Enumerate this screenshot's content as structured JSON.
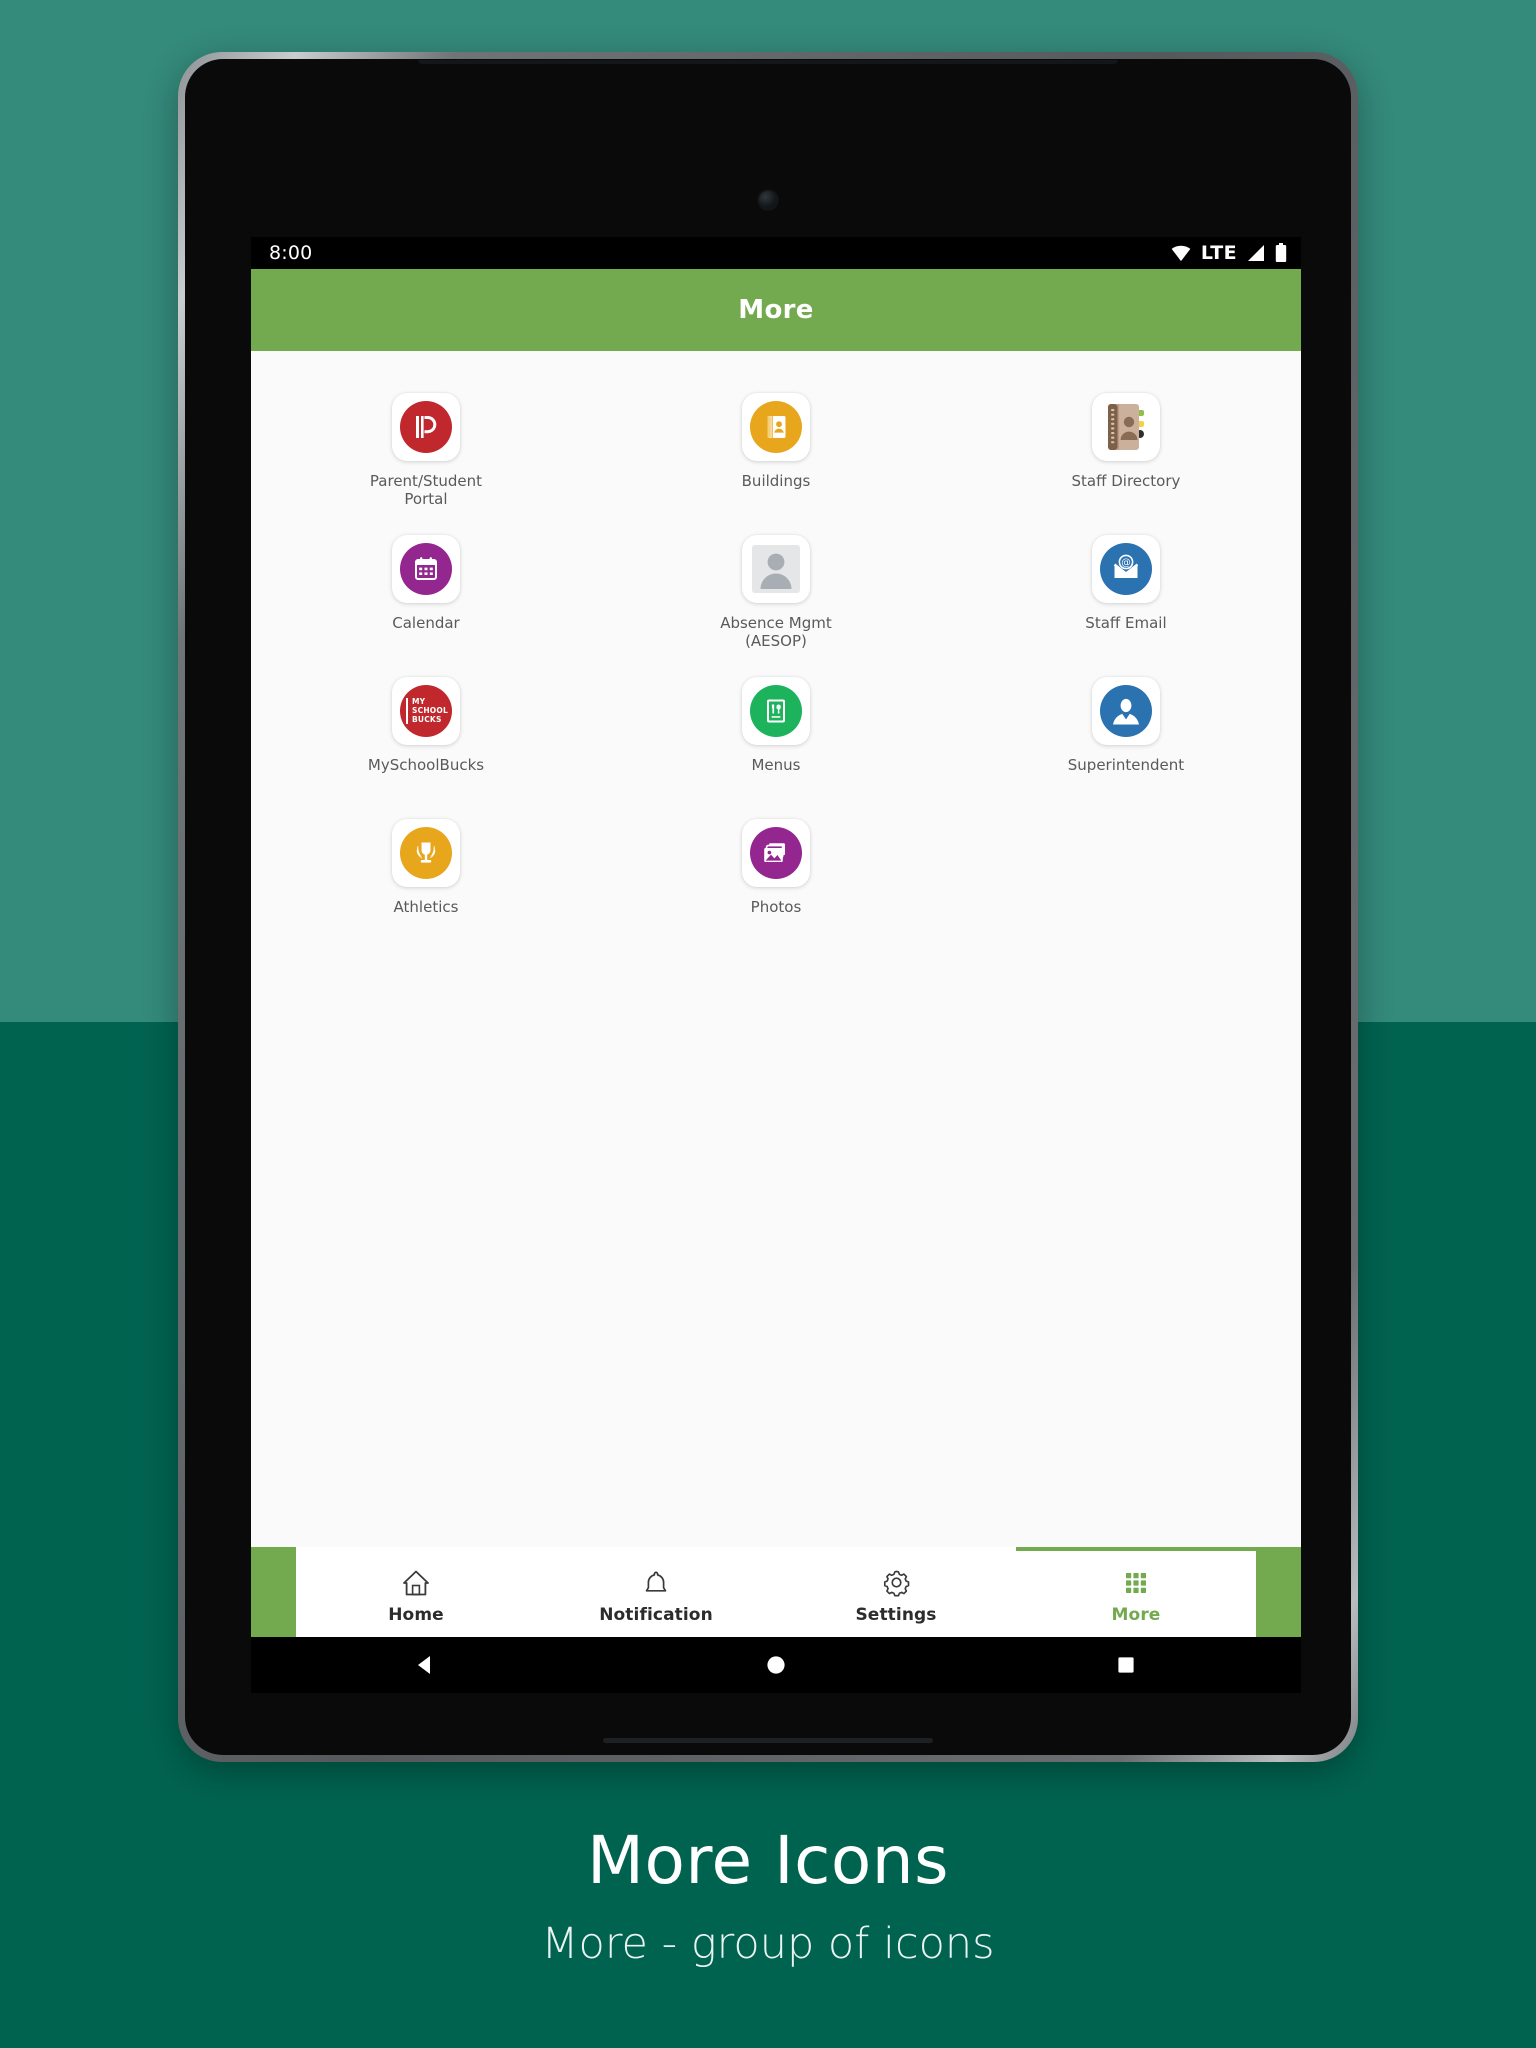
{
  "caption": {
    "title": "More Icons",
    "subtitle": "More - group of icons"
  },
  "colors": {
    "bg_top": "#348a7b",
    "bg_bottom": "#006350",
    "app_green": "#73a94f",
    "screen_bg": "#fafafa"
  },
  "status_bar": {
    "time": "8:00",
    "network": "LTE",
    "icons": [
      "wifi-icon",
      "signal-icon",
      "battery-icon"
    ]
  },
  "app_bar": {
    "title": "More"
  },
  "grid": {
    "rows": [
      [
        {
          "label": "Parent/Student\nPortal",
          "icon": "powerschool-icon",
          "color": "#c0282d"
        },
        {
          "label": "Buildings",
          "icon": "address-book-icon",
          "color": "#e8a61d"
        },
        {
          "label": "Staff Directory",
          "icon": "staff-directory-icon",
          "color": "#b79a86"
        }
      ],
      [
        {
          "label": "Calendar",
          "icon": "calendar-icon",
          "color": "#93278f"
        },
        {
          "label": "Absence Mgmt\n(AESOP)",
          "icon": "person-placeholder-icon",
          "color": "#e3e4e6"
        },
        {
          "label": "Staff Email",
          "icon": "email-at-icon",
          "color": "#2a72b0"
        }
      ],
      [
        {
          "label": "MySchoolBucks",
          "icon": "myschoolbucks-icon",
          "color": "#c0282d"
        },
        {
          "label": "Menus",
          "icon": "menu-card-icon",
          "color": "#1cb35c"
        },
        {
          "label": "Superintendent",
          "icon": "superintendent-icon",
          "color": "#2a72b0"
        }
      ],
      [
        {
          "label": "Athletics",
          "icon": "trophy-icon",
          "color": "#e8a61d"
        },
        {
          "label": "Photos",
          "icon": "photos-icon",
          "color": "#93278f"
        }
      ]
    ],
    "logo_text": {
      "myschoolbucks": [
        "MY",
        "SCHOOL",
        "BUCKS"
      ]
    }
  },
  "bottom_nav": {
    "items": [
      {
        "label": "Home",
        "icon": "home-icon",
        "active": false
      },
      {
        "label": "Notification",
        "icon": "bell-icon",
        "active": false
      },
      {
        "label": "Settings",
        "icon": "gear-icon",
        "active": false
      },
      {
        "label": "More",
        "icon": "grid-icon",
        "active": true
      }
    ]
  },
  "android_nav": {
    "keys": [
      "back-icon",
      "home-circle-icon",
      "recents-square-icon"
    ]
  }
}
